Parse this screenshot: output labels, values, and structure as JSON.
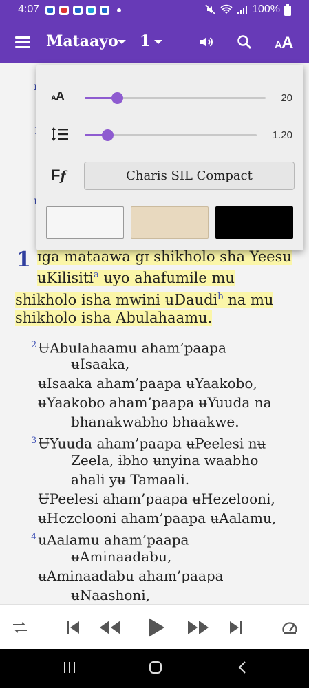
{
  "status_bar": {
    "time": "4:07",
    "battery": "100%",
    "icons": [
      "notification-app-icon",
      "notification-app-icon",
      "notification-app-icon",
      "notification-app-icon",
      "notification-app-icon",
      "mute-icon",
      "wifi-icon",
      "signal-icon",
      "battery-icon"
    ]
  },
  "app_bar": {
    "book": "Mataayo",
    "chapter": "1",
    "icons": [
      "menu-icon",
      "speaker-icon",
      "search-icon",
      "text-size-icon"
    ],
    "accent": "#673ab7"
  },
  "text_settings": {
    "text_size_icon_label": "AA",
    "text_size_value": "20",
    "text_size_level": 0.18,
    "line_height_value": "1.20",
    "line_height_level": 0.13,
    "font_icon_label": "Ff",
    "font_name": "Charis SIL Compact",
    "themes": [
      {
        "name": "white",
        "color": "#f6f6f6"
      },
      {
        "name": "sepia",
        "color": "#e8d9bf"
      },
      {
        "name": "black",
        "color": "#000000"
      }
    ],
    "slider_color": "#8e5bd0"
  },
  "content": {
    "chapter_number": "1",
    "verse_1": {
      "line1": "ɪga mataawa gɪ shikholo sha Yeesu",
      "line2a": "ʉKilisiti",
      "footnote_a": "a",
      "line2b": " ʉyo ahafumile mu",
      "line3a": "shikholo ɨsha mwɨnɨ ʉDaudi",
      "footnote_b": "b",
      "line3b": " na mu",
      "line4": "shikholo ɨsha Abulahaamu."
    },
    "verse_2_num": "2",
    "verse_3_num": "3",
    "verse_4_num": "4",
    "lines": [
      "ɄAbulahaamu aham’paapa",
      "ʉIsaaka,",
      "ʉIsaaka aham’paapa ʉYaakobo,",
      "ʉYaakobo aham’paapa ʉYuuda na",
      "bhanakwabho bhaakwe.",
      "ɄYuuda aham’paapa ʉPeelesi nʉ",
      "Zeela, ɨbho ʉnyina waabho",
      "ahali yʉ Tamaali.",
      "ɄPeelesi aham’paapa ʉHezelooni,",
      "ʉHezelooni aham’paapa ʉAalamu,",
      "ʉAalamu aham’paapa",
      "ʉAminaadabu,",
      "ʉAminaadabu aham’paapa",
      "ʉNaashoni,"
    ],
    "highlight_color": "#fbf6a8"
  },
  "player": {
    "icons": [
      "repeat-icon",
      "skip-previous-icon",
      "rewind-icon",
      "play-icon",
      "fast-forward-icon",
      "skip-next-icon",
      "speed-icon"
    ]
  },
  "navbar": {
    "icons": [
      "recent-apps-icon",
      "home-icon",
      "back-icon"
    ]
  }
}
